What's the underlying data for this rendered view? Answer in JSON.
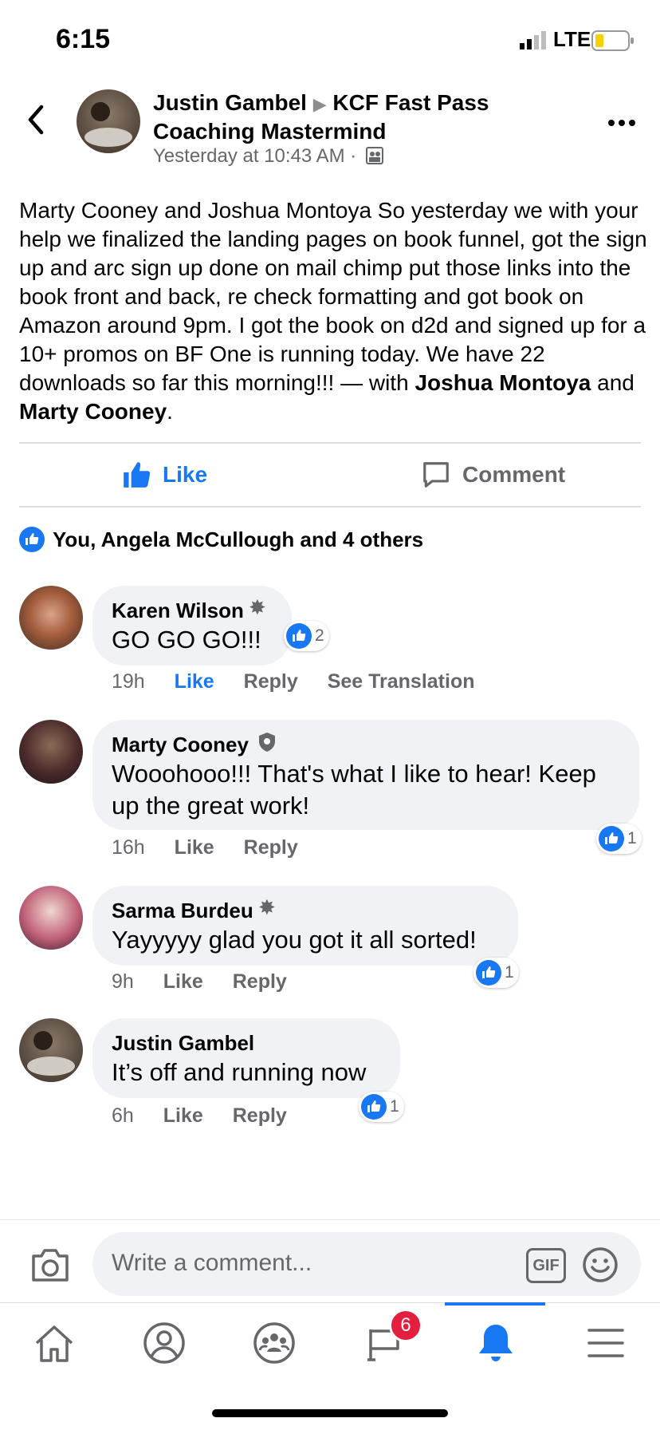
{
  "status_bar": {
    "time": "6:15",
    "network": "LTE"
  },
  "post": {
    "author": "Justin Gambel",
    "group": "KCF Fast Pass Coaching Mastermind",
    "timestamp": "Yesterday at 10:43 AM ·",
    "body": "Marty Cooney and Joshua Montoya So yesterday we with your help we finalized the landing pages on book funnel, got the sign up and arc sign up done on mail chimp put those links into the book front and back, re check formatting and got book on Amazon around 9pm. I got the book on d2d and signed up for a 10+ promos on BF One is running today. We have 22 downloads so far this morning!!! — with ",
    "tag1": "Joshua Montoya",
    "and": " and ",
    "tag2": "Marty Cooney",
    "end": "."
  },
  "actions": {
    "like": "Like",
    "comment": "Comment"
  },
  "reactions_summary": "You, Angela McCullough and 4 others",
  "comments": [
    {
      "name": "Karen Wilson",
      "text": "GO GO GO!!!",
      "time": "19h",
      "like": "Like",
      "reply": "Reply",
      "translate": "See Translation",
      "reactions": "2"
    },
    {
      "name": "Marty Cooney",
      "text": "Wooohooo!!! That's what I like to hear! Keep up the great work!",
      "time": "16h",
      "like": "Like",
      "reply": "Reply",
      "reactions": "1"
    },
    {
      "name": "Sarma Burdeu",
      "text": "Yayyyyy glad you got it all sorted!",
      "time": "9h",
      "like": "Like",
      "reply": "Reply",
      "reactions": "1"
    },
    {
      "name": "Justin Gambel",
      "text": "It’s off and running now",
      "time": "6h",
      "like": "Like",
      "reply": "Reply",
      "reactions": "1"
    }
  ],
  "composer": {
    "placeholder": "Write a comment...",
    "gif": "GIF"
  },
  "nav": {
    "notifications_badge": "6"
  },
  "colors": {
    "accent": "#1877f2",
    "badge": "#e41e3f",
    "muted": "#65676b"
  }
}
